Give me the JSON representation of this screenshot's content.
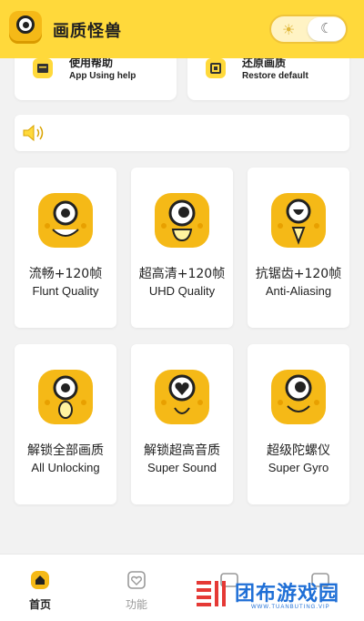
{
  "header": {
    "title": "画质怪兽",
    "logo_icon": "mascot-logo-icon",
    "toggle_icons": [
      "sun-icon",
      "moon-icon"
    ]
  },
  "help_cards": [
    {
      "title": "使用帮助",
      "subtitle": "App Using help",
      "icon": "help-book-icon"
    },
    {
      "title": "还原画质",
      "subtitle": "Restore default",
      "icon": "restore-icon"
    }
  ],
  "notice": {
    "icon": "speaker-icon",
    "text": ""
  },
  "features": [
    {
      "zh": "流畅+120帧",
      "en": "Flunt Quality",
      "mouth": "smile"
    },
    {
      "zh": "超高清+120帧",
      "en": "UHD Quality",
      "mouth": "open"
    },
    {
      "zh": "抗锯齿+120帧",
      "en": "Anti-Aliasing",
      "mouth": "fang"
    },
    {
      "zh": "解锁全部画质",
      "en": "All Unlocking",
      "mouth": "o"
    },
    {
      "zh": "解锁超高音质",
      "en": "Super Sound",
      "mouth": "heart"
    },
    {
      "zh": "超级陀螺仪",
      "en": "Super Gyro",
      "mouth": "grin"
    }
  ],
  "tabbar": {
    "tabs": [
      {
        "label": "首页",
        "icon": "home-icon",
        "active": true
      },
      {
        "label": "功能",
        "icon": "feature-heart-icon",
        "active": false
      },
      {
        "label": "",
        "icon": "mode-icon",
        "active": false
      },
      {
        "label": "",
        "icon": "profile-icon",
        "active": false
      }
    ]
  },
  "watermark": {
    "text": "团布游戏园",
    "subtext": "WWW.TUANBUTING.VIP"
  },
  "colors": {
    "accent": "#ffd93b",
    "mascot": "#f5b917",
    "text": "#222222",
    "watermark": "#1f6fd6"
  }
}
